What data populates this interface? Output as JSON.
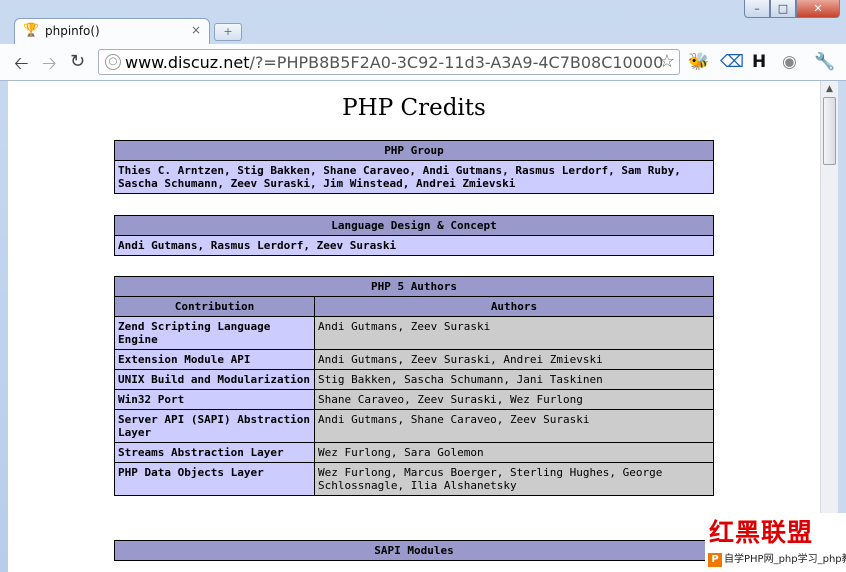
{
  "browser": {
    "tab_title": "phpinfo()",
    "tab_close": "×",
    "new_tab": "+",
    "url_domain": "www.discuz.net",
    "url_rest": "/?=PHPB8B5F2A0-3C92-11d3-A3A9-4C7B08C10000"
  },
  "page": {
    "title": "PHP Credits",
    "php_group": {
      "header": "PHP Group",
      "text": "Thies C. Arntzen, Stig Bakken, Shane Caraveo, Andi Gutmans, Rasmus Lerdorf, Sam Ruby, Sascha Schumann, Zeev Suraski, Jim Winstead, Andrei Zmievski"
    },
    "language_design": {
      "header": "Language Design & Concept",
      "text": "Andi Gutmans, Rasmus Lerdorf, Zeev Suraski"
    },
    "php5_authors": {
      "header": "PHP 5 Authors",
      "col_contribution": "Contribution",
      "col_authors": "Authors",
      "rows": [
        {
          "contribution": "Zend Scripting Language Engine",
          "authors": "Andi Gutmans, Zeev Suraski"
        },
        {
          "contribution": "Extension Module API",
          "authors": "Andi Gutmans, Zeev Suraski, Andrei Zmievski"
        },
        {
          "contribution": "UNIX Build and Modularization",
          "authors": "Stig Bakken, Sascha Schumann, Jani Taskinen"
        },
        {
          "contribution": "Win32 Port",
          "authors": "Shane Caraveo, Zeev Suraski, Wez Furlong"
        },
        {
          "contribution": "Server API (SAPI) Abstraction Layer",
          "authors": "Andi Gutmans, Shane Caraveo, Zeev Suraski"
        },
        {
          "contribution": "Streams Abstraction Layer",
          "authors": "Wez Furlong, Sara Golemon"
        },
        {
          "contribution": "PHP Data Objects Layer",
          "authors": "Wez Furlong, Marcus Boerger, Sterling Hughes, George Schlossnagle, Ilia Alshanetsky"
        }
      ]
    },
    "sapi_modules": {
      "header": "SAPI Modules"
    }
  },
  "watermark": {
    "brand": "红黑联盟",
    "icon": "P",
    "footer": "自学PHP网_php学习_php教程"
  }
}
